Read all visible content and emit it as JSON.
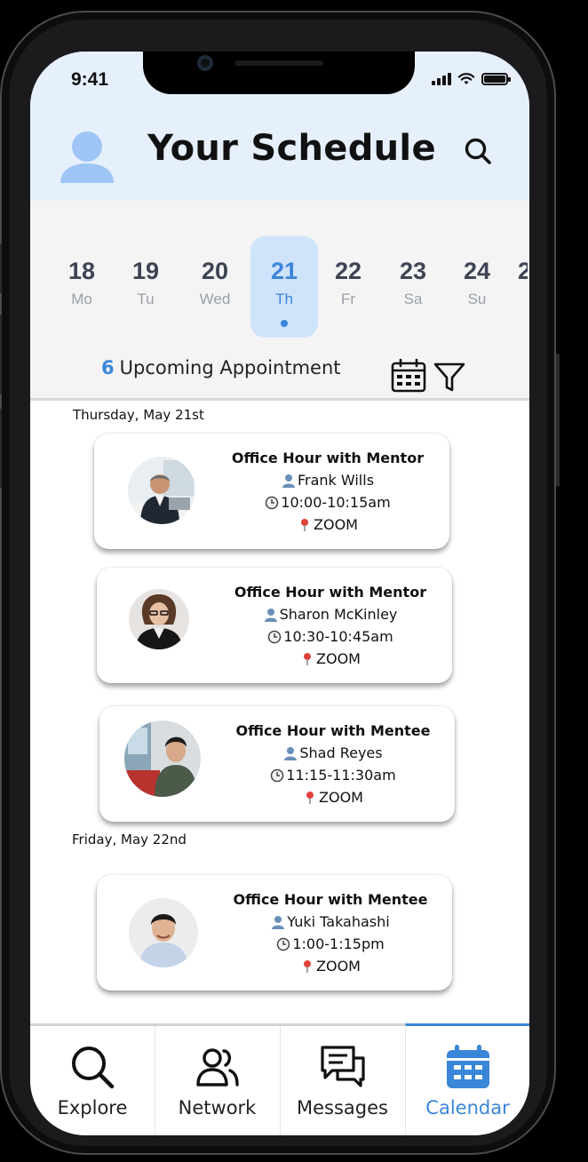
{
  "status": {
    "time": "9:41"
  },
  "header": {
    "title": "Your Schedule"
  },
  "dates": [
    {
      "num": "18",
      "wd": "Mo"
    },
    {
      "num": "19",
      "wd": "Tu"
    },
    {
      "num": "20",
      "wd": "Wed"
    },
    {
      "num": "21",
      "wd": "Th",
      "selected": true
    },
    {
      "num": "22",
      "wd": "Fr"
    },
    {
      "num": "23",
      "wd": "Sa"
    },
    {
      "num": "24",
      "wd": "Su"
    },
    {
      "num": "2",
      "wd": ""
    }
  ],
  "summary": {
    "count": "6",
    "label": "Upcoming Appointment"
  },
  "sections": [
    {
      "label": "Thursday, May 21st"
    },
    {
      "label": "Friday, May 22nd"
    }
  ],
  "appointments": [
    {
      "title": "Office Hour with Mentor",
      "person": "Frank Wills",
      "time": "10:00-10:15am",
      "location": "ZOOM"
    },
    {
      "title": "Office Hour with Mentor",
      "person": "Sharon McKinley",
      "time": "10:30-10:45am",
      "location": "ZOOM"
    },
    {
      "title": "Office Hour with Mentee",
      "person": "Shad Reyes",
      "time": "11:15-11:30am",
      "location": "ZOOM"
    },
    {
      "title": "Office Hour with Mentee",
      "person": "Yuki Takahashi",
      "time": "1:00-1:15pm",
      "location": "ZOOM"
    }
  ],
  "nav": [
    {
      "label": "Explore",
      "icon": "search-icon"
    },
    {
      "label": "Network",
      "icon": "people-icon"
    },
    {
      "label": "Messages",
      "icon": "chat-icon"
    },
    {
      "label": "Calendar",
      "icon": "calendar-icon",
      "active": true
    }
  ],
  "colors": {
    "accent": "#3a86d9",
    "header_bg": "#e6f0fc",
    "selected_day_bg": "#cfe3fb"
  }
}
